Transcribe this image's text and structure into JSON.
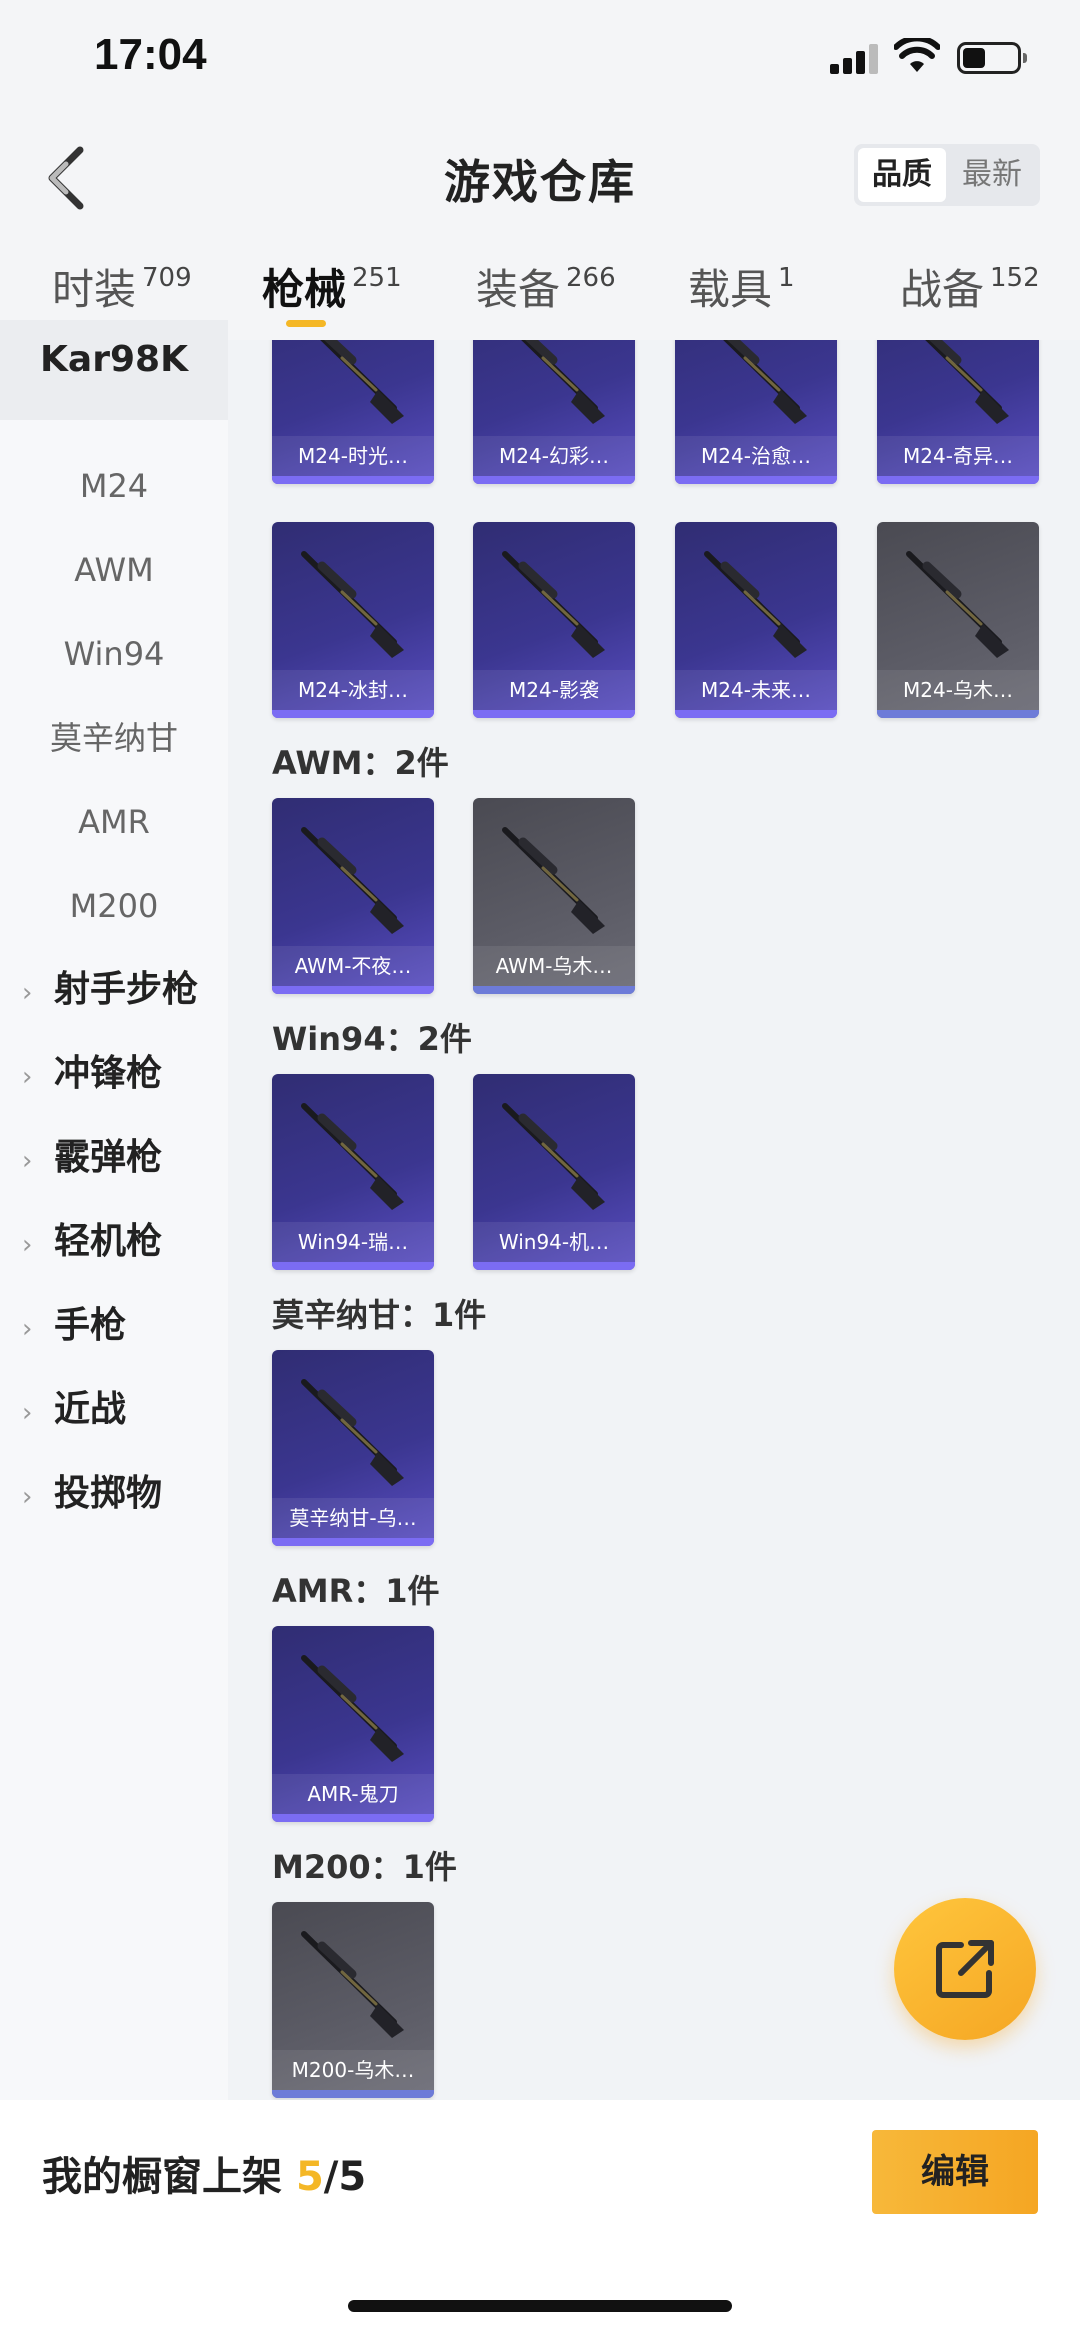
{
  "status": {
    "time": "17:04"
  },
  "header": {
    "title": "游戏仓库",
    "sort": {
      "active": "品质",
      "other": "最新"
    }
  },
  "tabs": [
    {
      "label": "时装",
      "count": "709"
    },
    {
      "label": "枪械",
      "count": "251",
      "active": true
    },
    {
      "label": "装备",
      "count": "266"
    },
    {
      "label": "载具",
      "count": "1"
    },
    {
      "label": "战备",
      "count": "152"
    }
  ],
  "sidebar": {
    "active": "Kar98K",
    "items": [
      "M24",
      "AWM",
      "Win94",
      "莫辛纳甘",
      "AMR",
      "M200"
    ],
    "categories": [
      "射手步枪",
      "冲锋枪",
      "霰弹枪",
      "轻机枪",
      "手枪",
      "近战",
      "投掷物"
    ]
  },
  "sections": [
    {
      "label": "",
      "items": [
        "M24-时光…",
        "M24-幻彩…",
        "M24-治愈…",
        "M24-奇异…",
        "M24-冰封…",
        "M24-影袭",
        "M24-未来…",
        "M24-乌木…"
      ]
    },
    {
      "label": "AWM：2件",
      "items": [
        "AWM-不夜…",
        "AWM-乌木…"
      ]
    },
    {
      "label": "Win94：2件",
      "items": [
        "Win94-瑞…",
        "Win94-机…"
      ]
    },
    {
      "label": "莫辛纳甘：1件",
      "items": [
        "莫辛纳甘-乌…"
      ]
    },
    {
      "label": "AMR：1件",
      "items": [
        "AMR-鬼刀"
      ]
    },
    {
      "label": "M200：1件",
      "items": [
        "M200-乌木…"
      ]
    }
  ],
  "bottom": {
    "showcase_label": "我的橱窗上架",
    "current": "5",
    "total": "/5",
    "edit_label": "编辑"
  },
  "colors": {
    "accent": "#f4b726",
    "card_purple": "#3b3690",
    "card_gray": "#5c5c66"
  }
}
